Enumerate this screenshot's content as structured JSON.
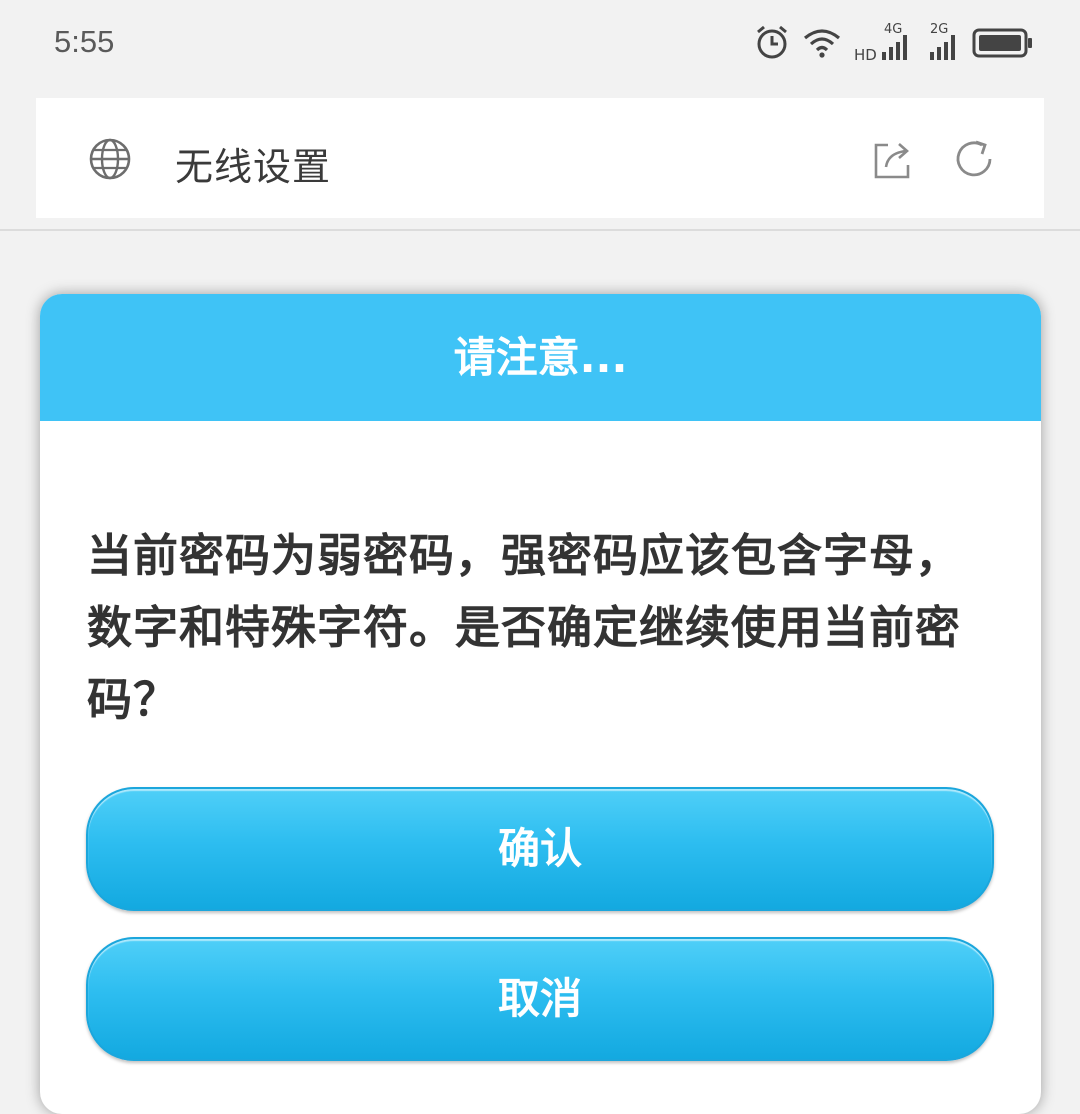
{
  "status_bar": {
    "time": "5:55",
    "icons": [
      "alarm-icon",
      "wifi-icon",
      "signal-4g-hd-icon",
      "signal-2g-icon",
      "battery-icon"
    ],
    "net_labels": {
      "hd": "HD",
      "g4": "4G",
      "g2": "2G"
    }
  },
  "url_bar": {
    "title": "无线设置",
    "icons": [
      "globe-icon",
      "share-icon",
      "reload-icon"
    ]
  },
  "dialog": {
    "title": "请注意...",
    "message": "当前密码为弱密码，强密码应该包含字母，数字和特殊字符。是否确定继续使用当前密码？",
    "confirm_label": "确认",
    "cancel_label": "取消"
  },
  "colors": {
    "header": "#3fc3f6",
    "button": "#2dbdf0",
    "background": "#f2f2f2"
  }
}
